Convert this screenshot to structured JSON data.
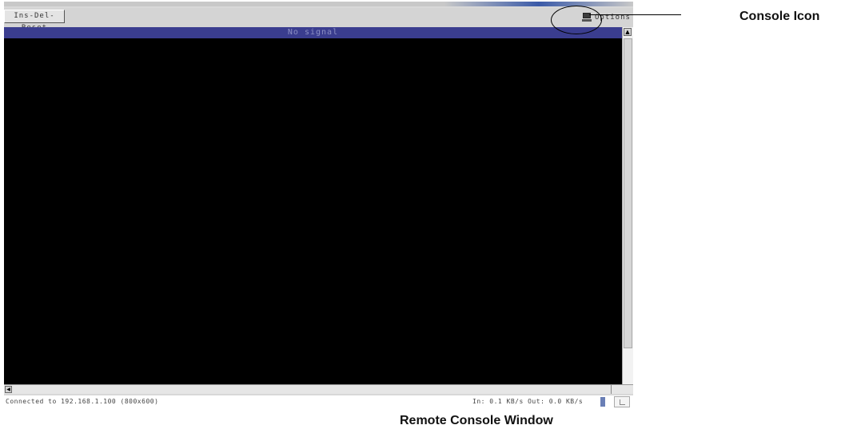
{
  "window": {
    "toolbar_button_label": "Ins-Del-Reset",
    "console_button_label": "Options",
    "title": "No signal",
    "status_left": "Connected to 192.168.1.100 (800x600)",
    "status_right": "In: 0.1 KB/s Out: 0.0 KB/s"
  },
  "annotations": {
    "console_icon_label": "Console Icon",
    "caption": "Remote Console Window"
  },
  "colors": {
    "titlebar": "#3a3d8f",
    "screen": "#000000"
  },
  "icons": [
    "console-icon",
    "scroll-up-arrow-icon",
    "scroll-left-arrow-icon"
  ]
}
